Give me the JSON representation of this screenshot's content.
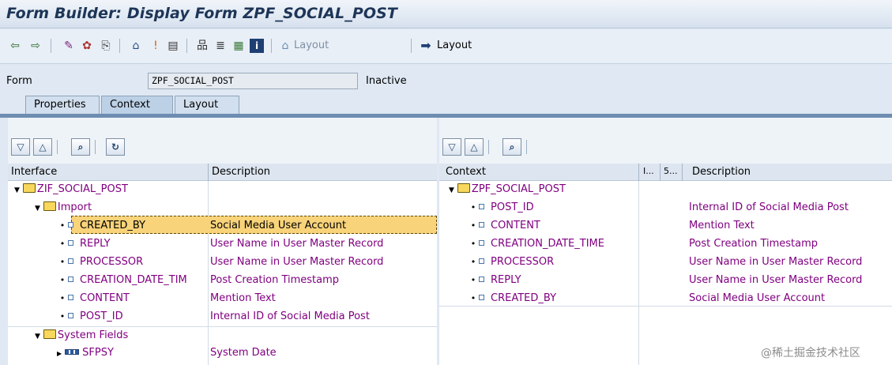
{
  "window": {
    "title": "Form Builder: Display Form ZPF_SOCIAL_POST"
  },
  "toolbar": {
    "icons": [
      "back-icon",
      "forward-icon",
      "display-change-icon",
      "other-object-icon",
      "activate-icon",
      "form-icon",
      "where-used-icon",
      "layout-icon",
      "hierarchy-icon",
      "structure-icon",
      "table-icon",
      "info-icon",
      "layout-small-icon",
      "navigate-icon"
    ],
    "layout_disabled_label": "Layout",
    "layout_label": "Layout"
  },
  "form": {
    "label": "Form",
    "value": "ZPF_SOCIAL_POST",
    "status": "Inactive"
  },
  "tabs": [
    {
      "label": "Properties"
    },
    {
      "label": "Context",
      "active": true
    },
    {
      "label": "Layout"
    }
  ],
  "interface_panel": {
    "headers": {
      "name": "Interface",
      "description": "Description"
    },
    "rows": [
      {
        "name": "ZIF_SOCIAL_POST",
        "description": "",
        "kind": "folder",
        "level": 0
      },
      {
        "name": "Import",
        "description": "",
        "kind": "folder",
        "level": 1
      },
      {
        "name": "CREATED_BY",
        "description": "Social Media User Account",
        "kind": "leaf",
        "level": 2,
        "selected": true
      },
      {
        "name": "REPLY",
        "description": "User Name in User Master Record",
        "kind": "leaf",
        "level": 2
      },
      {
        "name": "PROCESSOR",
        "description": "User Name in User Master Record",
        "kind": "leaf",
        "level": 2
      },
      {
        "name": "CREATION_DATE_TIM",
        "description": "Post Creation Timestamp",
        "kind": "leaf",
        "level": 2
      },
      {
        "name": "CONTENT",
        "description": "Mention Text",
        "kind": "leaf",
        "level": 2
      },
      {
        "name": "POST_ID",
        "description": "Internal ID of Social Media Post",
        "kind": "leaf",
        "level": 2
      },
      {
        "name": "System Fields",
        "description": "",
        "kind": "folder",
        "level": 1
      },
      {
        "name": "SFPSY",
        "description": "System Date",
        "kind": "struct",
        "level": 2
      }
    ]
  },
  "context_panel": {
    "headers": {
      "name": "Context",
      "col2": "I...",
      "col3": "5...",
      "description": "Description"
    },
    "rows": [
      {
        "name": "ZPF_SOCIAL_POST",
        "description": "",
        "kind": "folder"
      },
      {
        "name": "POST_ID",
        "description": "Internal ID of Social Media Post",
        "kind": "leaf"
      },
      {
        "name": "CONTENT",
        "description": "Mention Text",
        "kind": "leaf"
      },
      {
        "name": "CREATION_DATE_TIME",
        "description": "Post Creation Timestamp",
        "kind": "leaf"
      },
      {
        "name": "PROCESSOR",
        "description": "User Name in User Master Record",
        "kind": "leaf"
      },
      {
        "name": "REPLY",
        "description": "User Name in User Master Record",
        "kind": "leaf"
      },
      {
        "name": "CREATED_BY",
        "description": "Social Media User Account",
        "kind": "leaf"
      }
    ]
  },
  "watermark": "@稀土掘金技术社区"
}
